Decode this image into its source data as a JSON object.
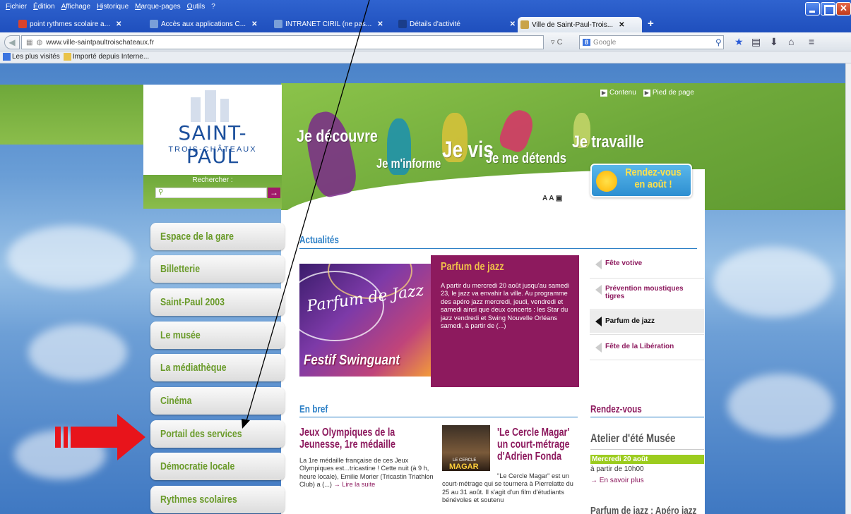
{
  "browser": {
    "menu": [
      "Fichier",
      "Édition",
      "Affichage",
      "Historique",
      "Marque-pages",
      "Outils",
      "?"
    ],
    "tabs": [
      {
        "title": "point rythmes scolaire a...",
        "close": "✕"
      },
      {
        "title": "Accès aux applications C...",
        "close": "✕"
      },
      {
        "title": "INTRANET CIRIL (ne pas...",
        "close": "✕"
      },
      {
        "title": "Détails d'activité",
        "close": "✕"
      },
      {
        "title": "Ville de Saint-Paul-Trois...",
        "close": "✕"
      }
    ],
    "new_tab": "+",
    "url": "www.ville-saintpaultroischateaux.fr",
    "search_engine": "Google",
    "search_badge": "8",
    "bookmarks": [
      "Les plus visités",
      "Importé depuis Interne..."
    ]
  },
  "site": {
    "logo": {
      "name": "SAINT-PAUL",
      "sub": "TROIS-CHÂTEAUX"
    },
    "search": {
      "label": "Rechercher :",
      "submit": "→"
    },
    "skip_links": [
      "Contenu",
      "Pied de page"
    ],
    "nav": {
      "decouvre": "Je découvre",
      "informe": "Je m'informe",
      "vis": "Je vis",
      "detends": "Je me détends",
      "travaille": "Je travaille"
    },
    "rendezvous_bubble": "Rendez-vous en août !",
    "font_tools": "A A",
    "menu": [
      "Espace de la gare",
      "Billetterie",
      "Saint-Paul 2003",
      "Le musée",
      "La médiathèque",
      "Cinéma",
      "Portail des services",
      "Démocratie locale",
      "Rythmes scolaires"
    ],
    "actualites": {
      "title": "Actualités",
      "feature": {
        "image_text": "Festif Swinguant",
        "image_script": "Parfum de Jazz",
        "title": "Parfum de jazz",
        "body": "A partir du mercredi 20 août jusqu'au samedi 23, le jazz va envahir la ville. Au programme des apéro jazz mercredi, jeudi, vendredi et samedi ainsi que deux concerts : les Star du jazz vendredi et Swing Nouvelle Orléans samedi, à partir de (...)"
      },
      "list": [
        "Fête votive",
        "Prévention moustiques tigres",
        "Parfum de jazz",
        "Fête de la Libération"
      ]
    },
    "en_bref": {
      "title": "En bref",
      "items": [
        {
          "title": "Jeux Olympiques de la Jeunesse, 1re médaille",
          "body": "La 1re médaille française de ces Jeux Olympiques est...tricastine ! Cette nuit (à 9 h, heure locale), Emilie Morier (Tricastin Triathlon Club) a (...)",
          "more": "Lire la suite"
        },
        {
          "title": "'Le Cercle Magar' un court-métrage d'Adrien Fonda",
          "body": "\"Le Cercle Magar\" est un court-métrage qui se tournera à Pierrelatte du 25 au 31 août. Il s'agit d'un film d'étudiants bénévoles et soutenu",
          "image_top": "LE CERCLE",
          "image_label": "MAGAR"
        }
      ]
    },
    "rendezvous": {
      "title": "Rendez-vous",
      "event": "Atelier d'été Musée",
      "date": "Mercredi 20 août",
      "time": "à partir de 10h00",
      "more": "En savoir plus",
      "next_event": "Parfum de jazz : Apéro jazz"
    }
  },
  "colors": {
    "accent_green": "#6ea83a",
    "accent_magenta": "#8d1a5e",
    "link_blue": "#2b7fc6"
  }
}
